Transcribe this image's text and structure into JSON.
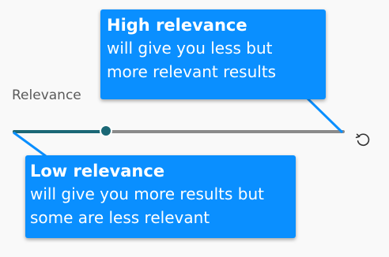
{
  "relevance": {
    "label": "Relevance",
    "value": 0.28,
    "reset_icon": "reset-rotate-ccw-icon"
  },
  "callouts": {
    "high": {
      "title": "High relevance",
      "body_line1": "will give you less but",
      "body_line2": "more relevant results"
    },
    "low": {
      "title": "Low relevance",
      "body_line1": "will give you more results but",
      "body_line2": "some are less relevant"
    }
  },
  "colors": {
    "callout_bg": "#0a8fff",
    "slider_accent": "#1b6876",
    "track": "#8a8a8a",
    "leader_line": "#0a8fff"
  }
}
